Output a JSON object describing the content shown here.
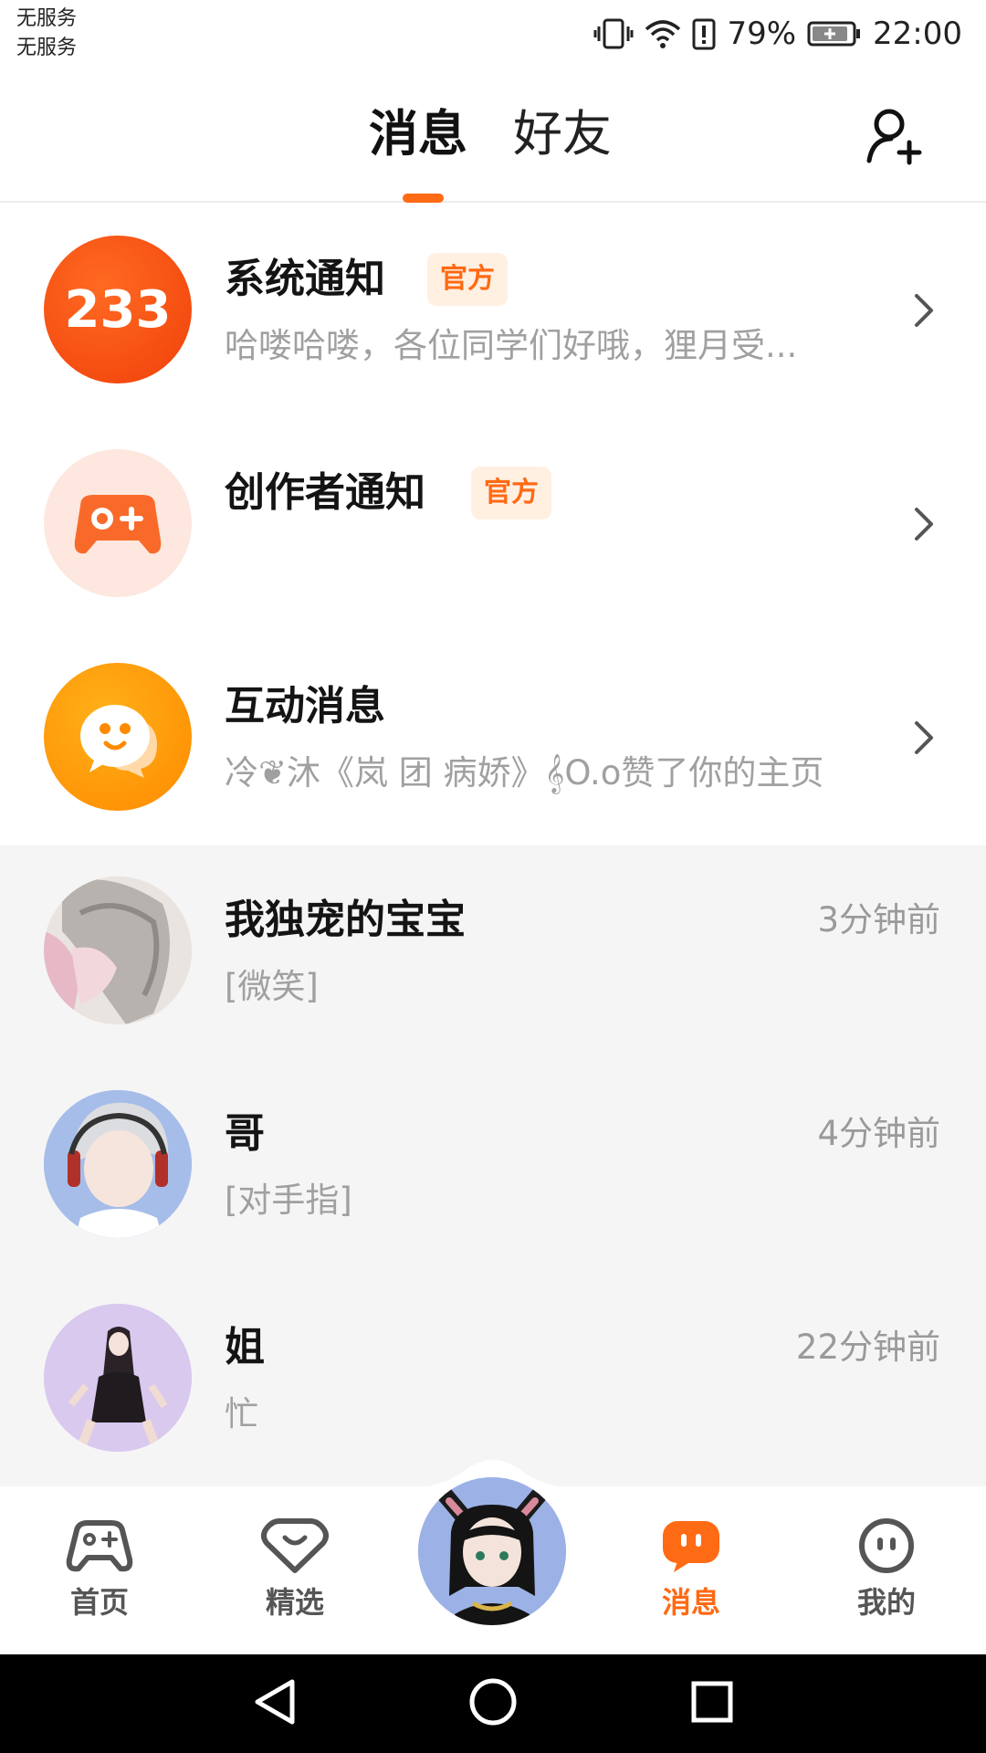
{
  "status_bar": {
    "carrier_1": "无服务",
    "carrier_2": "无服务",
    "battery": "79%",
    "time": "22:00"
  },
  "header": {
    "tab_messages": "消息",
    "tab_friends": "好友"
  },
  "official_badge": "官方",
  "system_rows": [
    {
      "title": "系统通知",
      "badge": "官方",
      "subtitle": "哈喽哈喽，各位同学们好哦，狸月受...",
      "logo_text": "233"
    },
    {
      "title": "创作者通知",
      "badge": "官方",
      "subtitle": ""
    },
    {
      "title": "互动消息",
      "subtitle": "冷❦沐《岚 团 病娇》𝄞O.o赞了你的主页"
    }
  ],
  "chats": [
    {
      "name": "我独宠的宝宝",
      "preview": "[微笑]",
      "time": "3分钟前"
    },
    {
      "name": "哥",
      "preview": "[对手指]",
      "time": "4分钟前"
    },
    {
      "name": "姐",
      "preview": "忙",
      "time": "22分钟前"
    }
  ],
  "bottom_nav": {
    "home": "首页",
    "featured": "精选",
    "messages": "消息",
    "mine": "我的"
  },
  "colors": {
    "accent": "#ff6a14",
    "badge_bg": "#fff0e2",
    "gray_bg": "#f5f5f6"
  }
}
